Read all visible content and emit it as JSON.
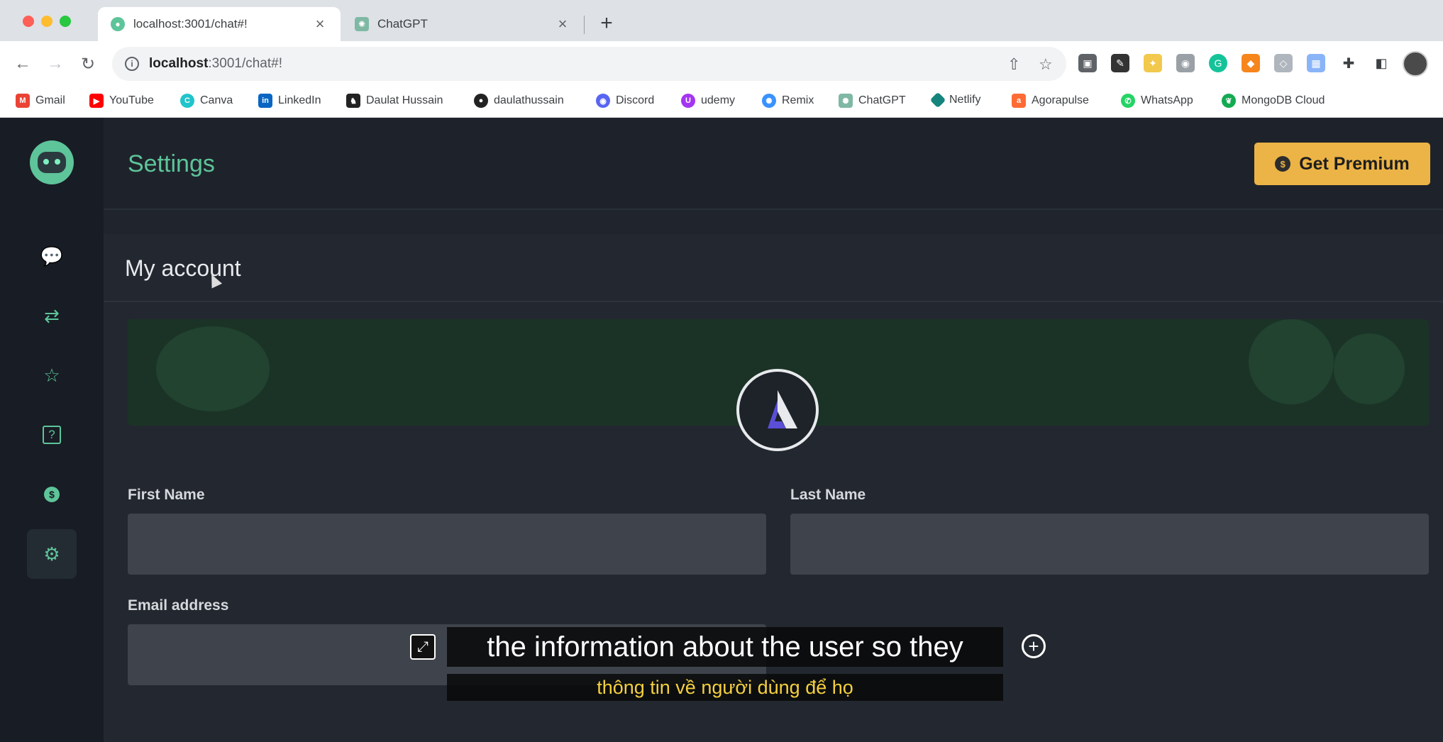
{
  "browser": {
    "tabs": [
      {
        "title": "localhost:3001/chat#!",
        "active": true
      },
      {
        "title": "ChatGPT",
        "active": false
      }
    ],
    "url_host": "localhost",
    "url_path": ":3001/chat#!",
    "bookmarks": [
      {
        "label": "Gmail",
        "icon": "gmail-icon",
        "color": "#ea4335"
      },
      {
        "label": "YouTube",
        "icon": "youtube-icon",
        "color": "#ff0000"
      },
      {
        "label": "Canva",
        "icon": "canva-icon",
        "color": "#20c4cb"
      },
      {
        "label": "LinkedIn",
        "icon": "linkedin-icon",
        "color": "#0a66c2"
      },
      {
        "label": "Daulat Hussain",
        "icon": "horse-icon",
        "color": "#222222"
      },
      {
        "label": "daulathussain",
        "icon": "github-icon",
        "color": "#222222"
      },
      {
        "label": "Discord",
        "icon": "discord-icon",
        "color": "#5865f2"
      },
      {
        "label": "udemy",
        "icon": "udemy-icon",
        "color": "#a435f0"
      },
      {
        "label": "Remix",
        "icon": "remix-icon",
        "color": "#3992ff"
      },
      {
        "label": "ChatGPT",
        "icon": "chatgpt-icon",
        "color": "#10a37f"
      },
      {
        "label": "Netlify",
        "icon": "netlify-icon",
        "color": "#15847d"
      },
      {
        "label": "Agorapulse",
        "icon": "agorapulse-icon",
        "color": "#ff6b35"
      },
      {
        "label": "WhatsApp",
        "icon": "whatsapp-icon",
        "color": "#25d366"
      },
      {
        "label": "MongoDB Cloud",
        "icon": "mongodb-icon",
        "color": "#13aa52"
      }
    ]
  },
  "app": {
    "page_title": "Settings",
    "premium_label": "Get Premium",
    "premium_coin": "$",
    "sidebar": [
      {
        "name": "sidebar-item-chat",
        "icon": "chat-bubble-icon",
        "glyph": "💬"
      },
      {
        "name": "sidebar-item-swap",
        "icon": "swap-arrows-icon",
        "glyph": "⇄"
      },
      {
        "name": "sidebar-item-favorites",
        "icon": "star-icon",
        "glyph": "☆"
      },
      {
        "name": "sidebar-item-help",
        "icon": "question-box-icon",
        "glyph": "?"
      },
      {
        "name": "sidebar-item-billing",
        "icon": "dollar-coin-icon",
        "glyph": "$"
      },
      {
        "name": "sidebar-item-settings",
        "icon": "gear-icon",
        "glyph": "⚙",
        "active": true
      }
    ],
    "account": {
      "title": "My account",
      "first_name_label": "First Name",
      "last_name_label": "Last Name",
      "email_label": "Email address",
      "first_name_value": "",
      "last_name_value": "",
      "email_value": ""
    }
  },
  "captions": {
    "main": "the information about the user so they",
    "translation": "thông tin về người dùng để họ"
  },
  "colors": {
    "accent": "#5ec49a",
    "premium": "#ecb446",
    "caption_translation": "#f4d03f"
  }
}
